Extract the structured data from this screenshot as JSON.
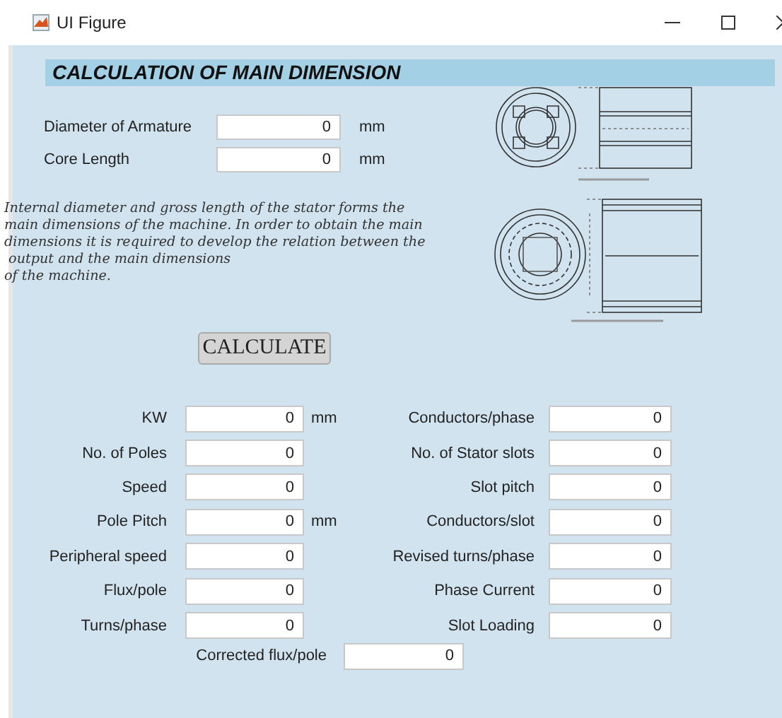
{
  "window": {
    "title": "UI Figure"
  },
  "heading": "CALCULATION OF MAIN DIMENSION",
  "inputs": [
    {
      "label": "Diameter of Armature",
      "value": "0",
      "unit": "mm"
    },
    {
      "label": "Core Length",
      "value": "0",
      "unit": "mm"
    }
  ],
  "description": "Internal diameter and gross length of the stator forms the\nmain dimensions of the machine. In order to obtain the main\ndimensions it is required to develop the relation between the\n output and the main dimensions\nof the machine.",
  "calculate_button": "CALCULATE",
  "results_left": [
    {
      "label": "KW",
      "value": "0",
      "unit": "mm"
    },
    {
      "label": "No. of Poles",
      "value": "0"
    },
    {
      "label": "Speed",
      "value": "0"
    },
    {
      "label": "Pole Pitch",
      "value": "0",
      "unit": "mm"
    },
    {
      "label": "Peripheral speed",
      "value": "0"
    },
    {
      "label": "Flux/pole",
      "value": "0"
    },
    {
      "label": "Turns/phase",
      "value": "0"
    }
  ],
  "results_right": [
    {
      "label": "Conductors/phase",
      "value": "0"
    },
    {
      "label": "No. of Stator slots",
      "value": "0"
    },
    {
      "label": "Slot pitch",
      "value": "0"
    },
    {
      "label": "Conductors/slot",
      "value": "0"
    },
    {
      "label": "Revised turns/phase",
      "value": "0"
    },
    {
      "label": "Phase Current",
      "value": "0"
    },
    {
      "label": "Slot Loading",
      "value": "0"
    }
  ],
  "result_bottom": {
    "label": "Corrected flux/pole",
    "value": "0"
  }
}
